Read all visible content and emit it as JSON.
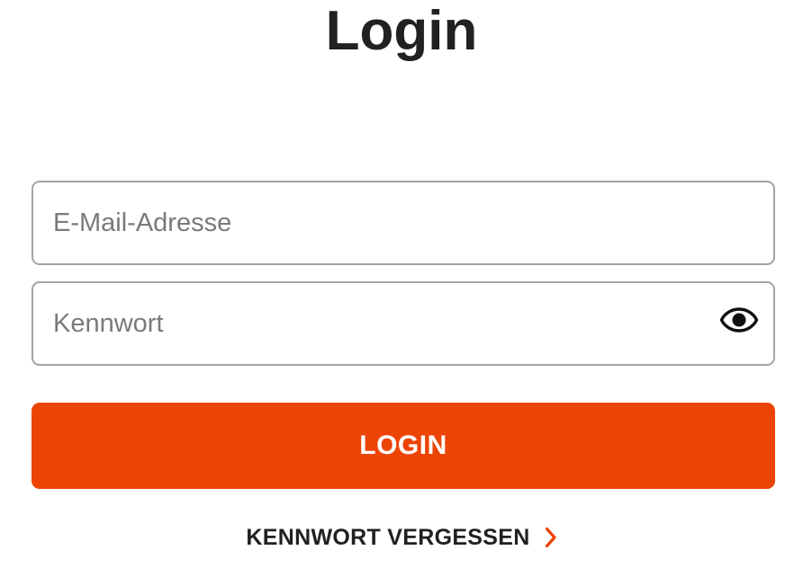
{
  "page": {
    "title": "Login"
  },
  "form": {
    "email": {
      "placeholder": "E-Mail-Adresse",
      "value": ""
    },
    "password": {
      "placeholder": "Kennwort",
      "value": "",
      "visibility_icon": "eye-icon"
    },
    "submit_label": "LOGIN",
    "forgot_label": "KENNWORT VERGESSEN",
    "forgot_icon": "chevron-right-icon"
  },
  "colors": {
    "accent": "#ec4405",
    "text": "#212121",
    "placeholder": "#7a7a7a",
    "border": "#a3a3a3",
    "background": "#ffffff"
  }
}
